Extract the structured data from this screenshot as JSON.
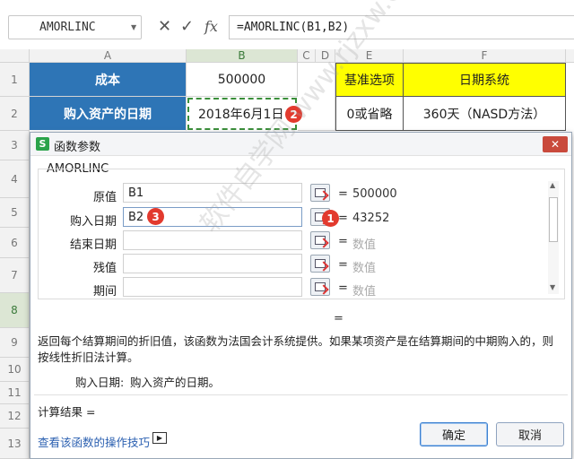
{
  "formula_bar": {
    "name_box": "AMORLINC",
    "cancel_icon": "✕",
    "confirm_icon": "✓",
    "fx_label": "fx",
    "formula": "=AMORLINC(B1,B2)"
  },
  "columns": [
    "A",
    "B",
    "C",
    "D",
    "E",
    "F"
  ],
  "rows": [
    "1",
    "2",
    "3",
    "4",
    "5",
    "6",
    "7",
    "8",
    "9",
    "10",
    "11",
    "12",
    "13"
  ],
  "cells": {
    "A1": "成本",
    "B1": "500000",
    "E1": "基准选项",
    "F1": "日期系统",
    "A2": "购入资产的日期",
    "B2": "2018年6月1日",
    "E2": "0或省略",
    "F2": "360天（NASD方法）"
  },
  "colors": {
    "blue_header": "#2e75b6",
    "yellow_header": "#ffff00",
    "badge_red": "#e23a2e"
  },
  "dialog": {
    "title": "函数参数",
    "function_name": "AMORLINC",
    "args": [
      {
        "label": "原值",
        "value": "B1",
        "result": "500000"
      },
      {
        "label": "购入日期",
        "value": "B2",
        "result": "43252"
      },
      {
        "label": "结束日期",
        "value": "",
        "result": "数值"
      },
      {
        "label": "残值",
        "value": "",
        "result": "数值"
      },
      {
        "label": "期间",
        "value": "",
        "result": "数值"
      }
    ],
    "eq": "=",
    "formula_result_eq": "=",
    "description": "返回每个结算期间的折旧值，该函数为法国会计系统提供。如果某项资产是在结算期间的中期购入的，则按线性折旧法计算。",
    "arg_help_label": "购入日期:",
    "arg_help_text": "购入资产的日期。",
    "result_label": "计算结果 =",
    "help_link": "查看该函数的操作技巧",
    "ok_label": "确定",
    "cancel_label": "取消"
  },
  "badges": {
    "b1": "1",
    "b2": "2",
    "b3": "3"
  },
  "watermark": "软件自学网 www.rjzxw.com"
}
